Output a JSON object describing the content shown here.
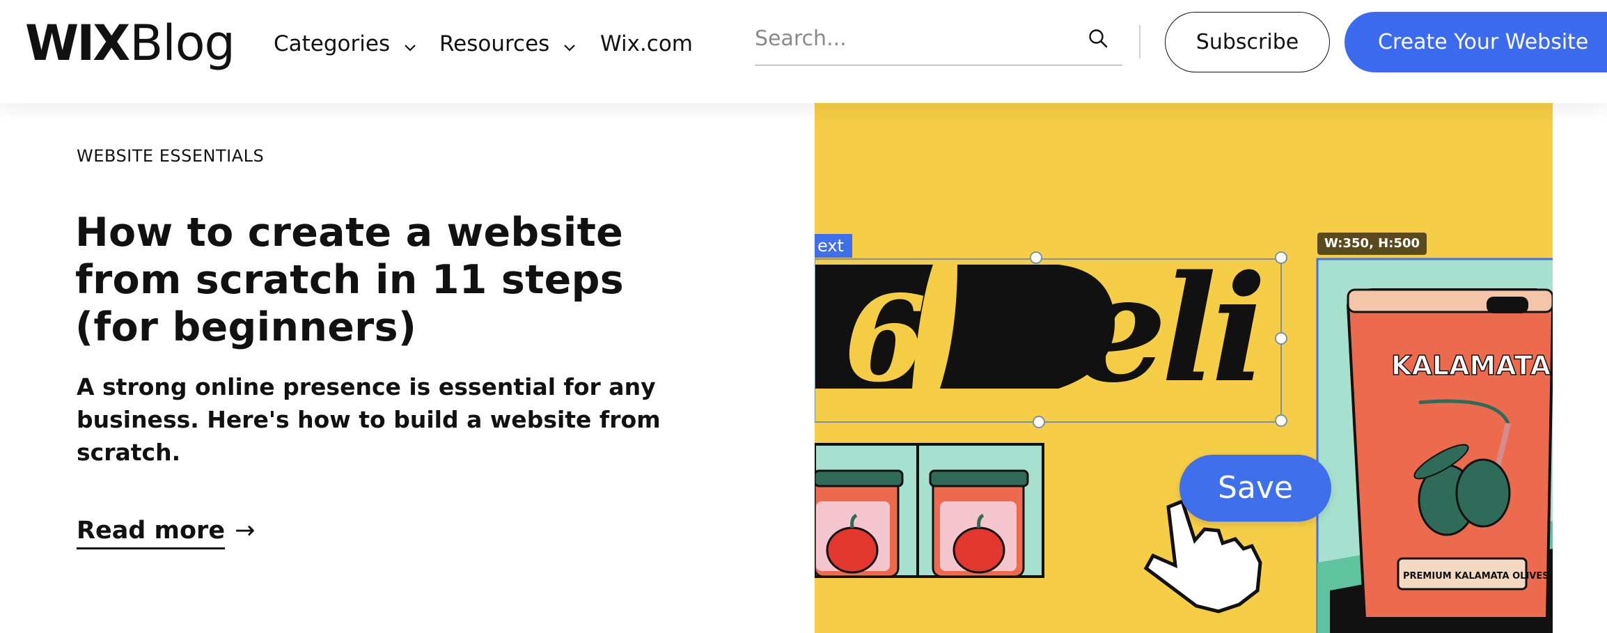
{
  "header": {
    "logo_wix": "WIX",
    "logo_blog": "Blog",
    "nav": {
      "categories": "Categories",
      "resources": "Resources",
      "wix": "Wix.com"
    },
    "search_placeholder": "Search...",
    "subscribe_label": "Subscribe",
    "create_label": "Create Your Website"
  },
  "article": {
    "category": "WEBSITE ESSENTIALS",
    "title": "How to create a website from scratch in 11 steps (for beginners)",
    "excerpt": "A strong online presence is essential for any business. Here's how to build a website from scratch.",
    "read_more": "Read more",
    "read_more_arrow": "→"
  },
  "hero": {
    "text_tag": "ext",
    "logo_number": "6",
    "logo_word": "Deli",
    "dimension_tag": "W:350, H:500",
    "save_label": "Save",
    "can_label": "KALAMATA",
    "can_sublabel": "PREMIUM KALAMATA OLIVES"
  },
  "colors": {
    "accent_blue": "#3c6bf0",
    "hero_yellow": "#f5cd46",
    "mint": "#a8e0cf",
    "can_orange": "#ec6a4e",
    "jar_pink": "#f6c6cf",
    "tomato_red": "#e2372e",
    "olive_green": "#2f6b58"
  },
  "icons": {
    "search": "search-icon",
    "chevron": "chevron-down-icon",
    "arrow": "arrow-right-icon",
    "cursor": "hand-pointer-icon"
  }
}
